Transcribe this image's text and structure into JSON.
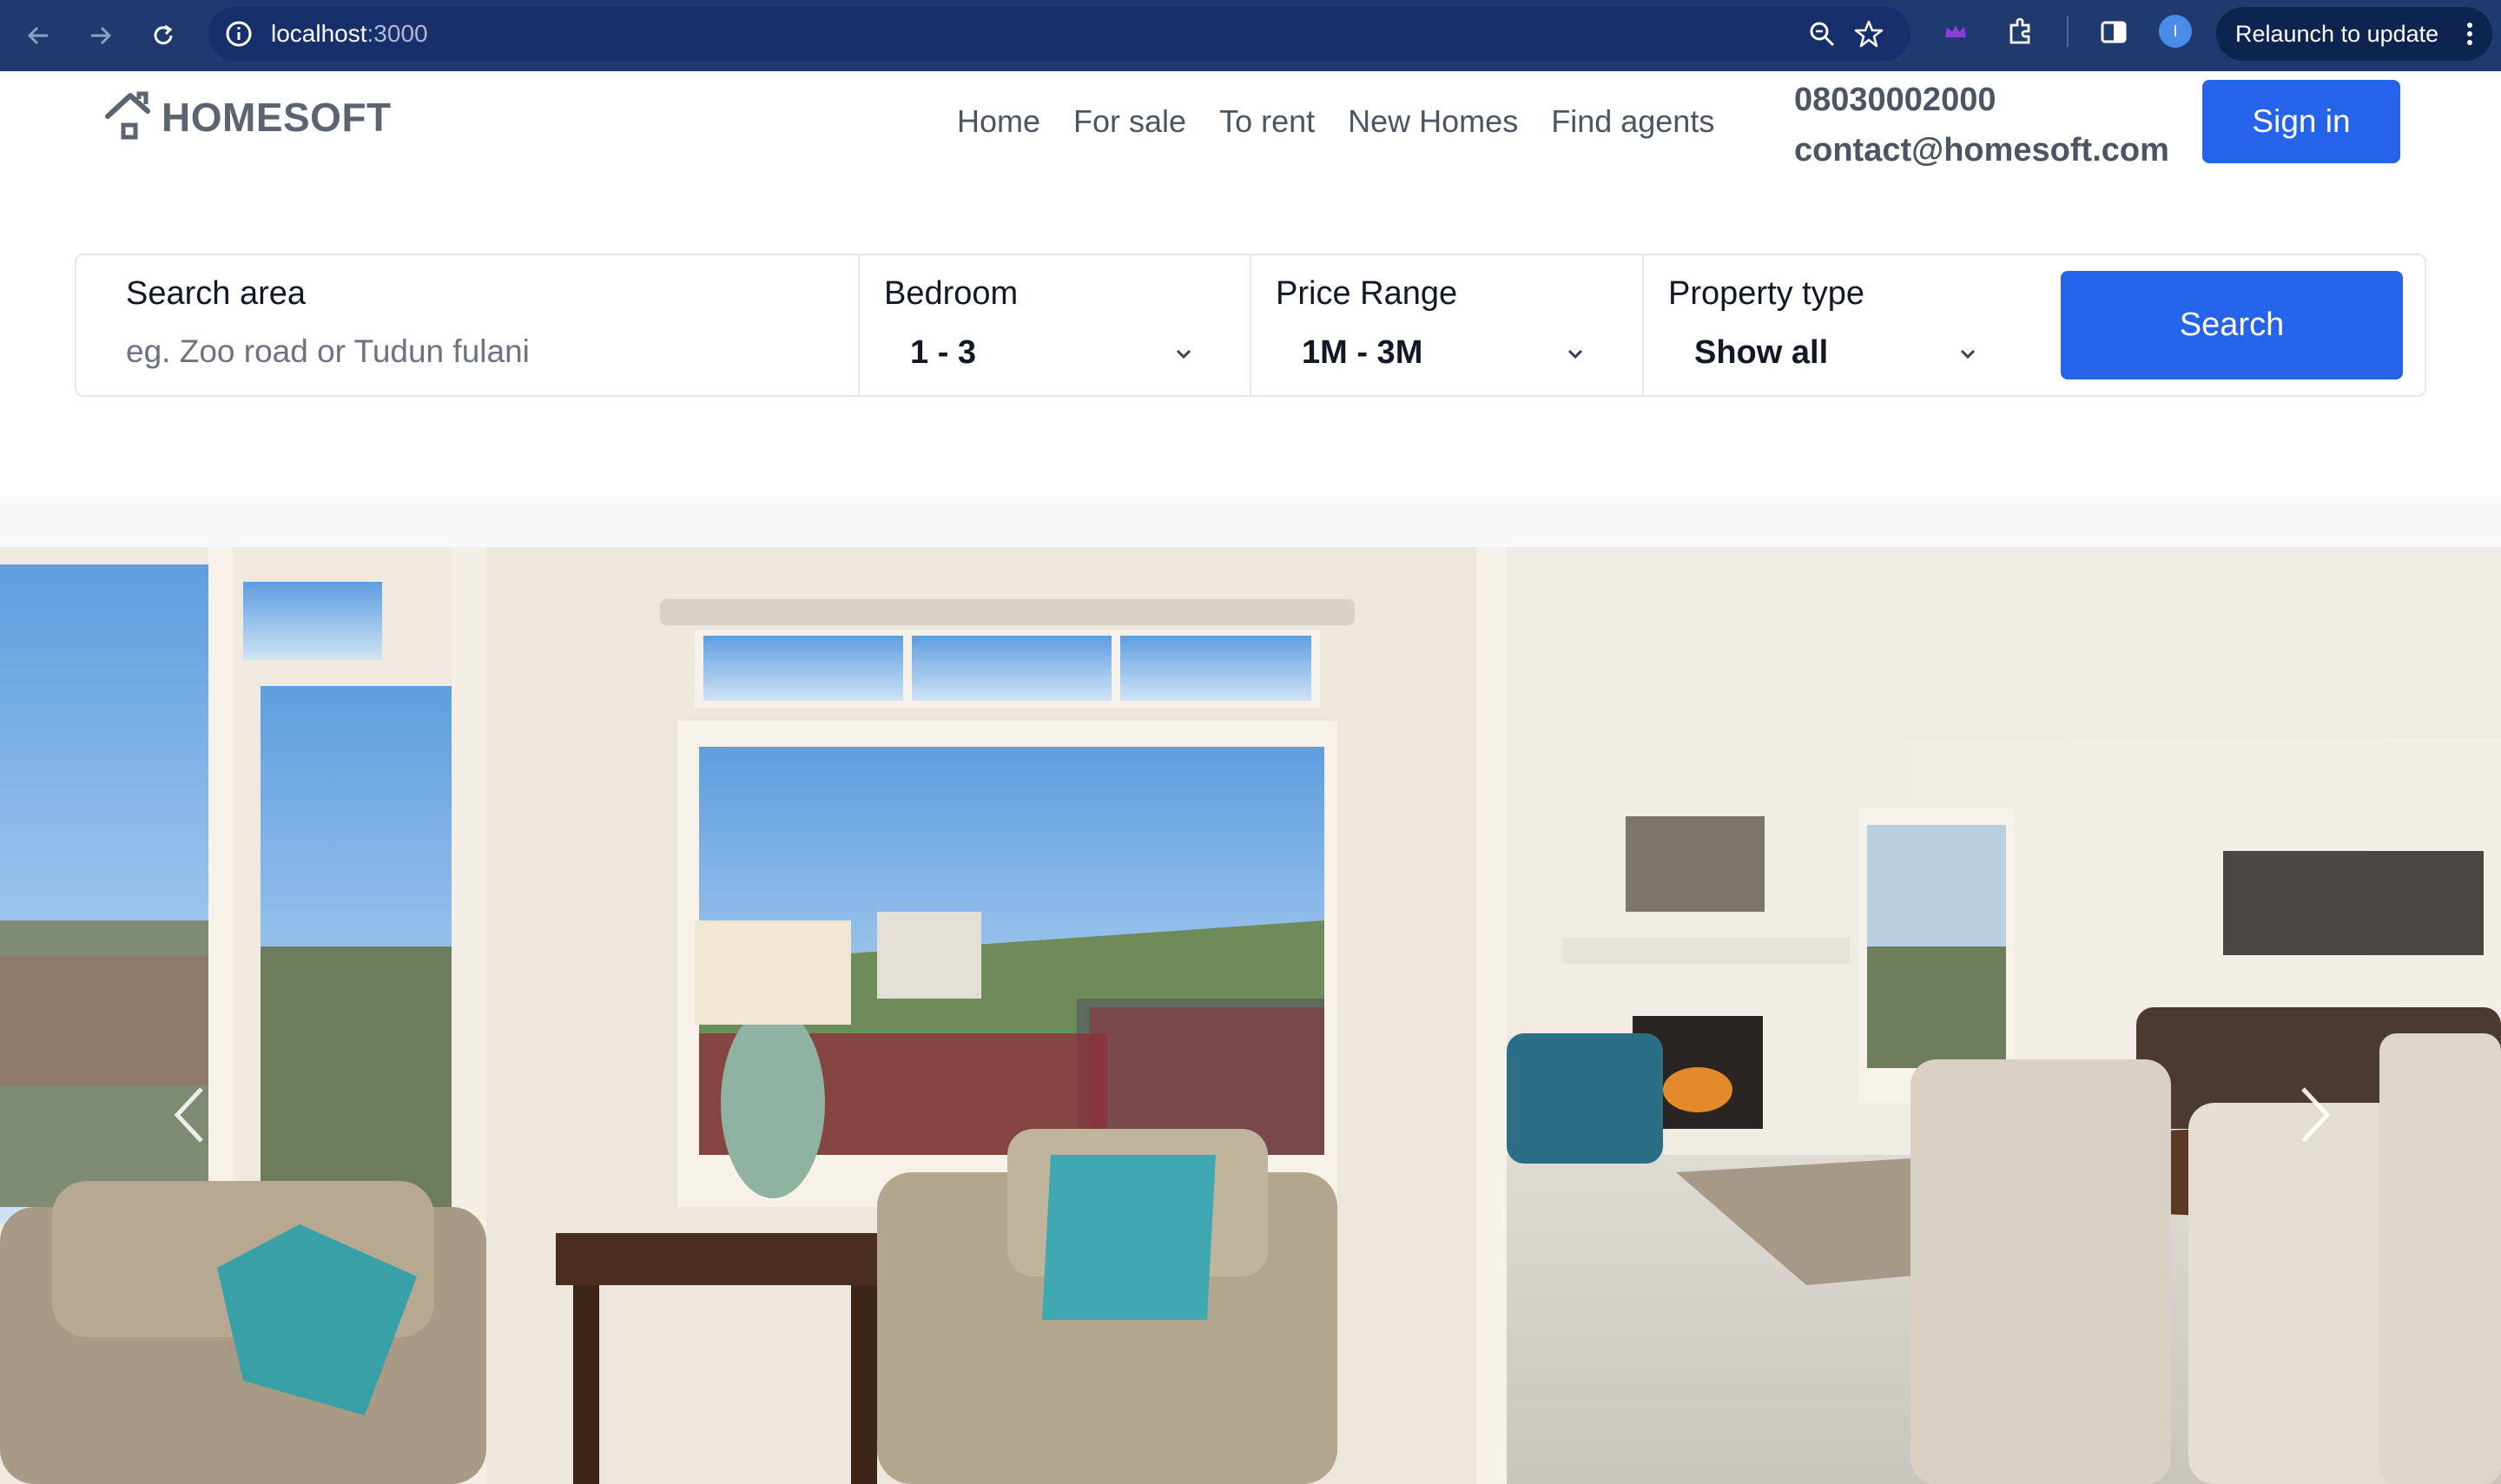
{
  "browser": {
    "url_host": "localhost",
    "url_port": ":3000",
    "relaunch_label": "Relaunch to update",
    "profile_initial": "I"
  },
  "site": {
    "logo_text": "HOMESOFT",
    "nav": [
      "Home",
      "For sale",
      "To rent",
      "New Homes",
      "Find agents"
    ],
    "phone": "08030002000",
    "email": "contact@homesoft.com",
    "signin_label": "Sign in"
  },
  "search": {
    "area_label": "Search area",
    "area_placeholder": "eg. Zoo road or Tudun fulani",
    "bedroom_label": "Bedroom",
    "bedroom_value": "1 - 3",
    "price_label": "Price Range",
    "price_value": "1M - 3M",
    "type_label": "Property type",
    "type_value": "Show all",
    "button_label": "Search"
  },
  "hero": {
    "prev_icon": "chevron-left-icon",
    "next_icon": "chevron-right-icon"
  },
  "colors": {
    "brand_blue": "#2563eb",
    "chrome_bg": "#1f3a6e"
  }
}
